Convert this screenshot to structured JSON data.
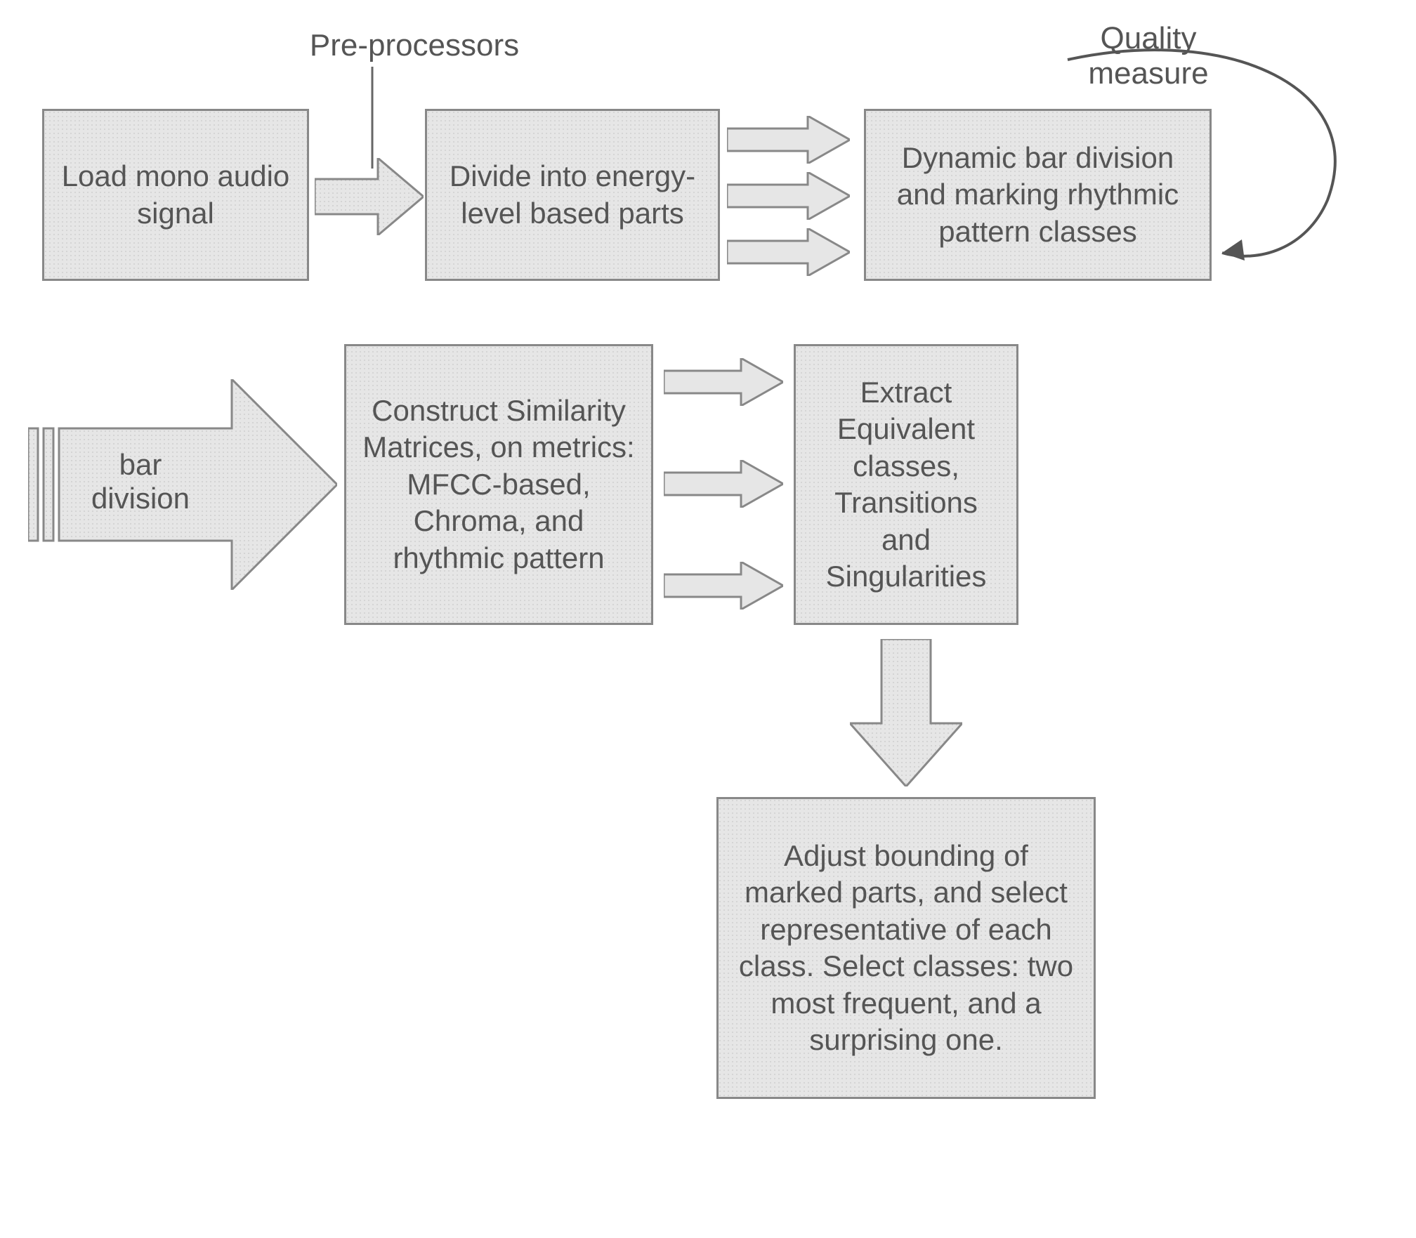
{
  "labels": {
    "preprocessors": "Pre-processors",
    "quality": "Quality\nmeasure",
    "bar_division": "bar\ndivision"
  },
  "boxes": {
    "load": "Load mono audio signal",
    "divide": "Divide into energy-level based parts",
    "dynamic": "Dynamic bar division and marking rhythmic pattern  classes",
    "construct": "Construct Similarity Matrices, on metrics: MFCC-based, Chroma, and rhythmic pattern",
    "extract": "Extract Equivalent classes, Transitions and Singularities",
    "adjust": "Adjust bounding of marked parts, and select representative of each class. Select classes: two most frequent, and a surprising one."
  }
}
